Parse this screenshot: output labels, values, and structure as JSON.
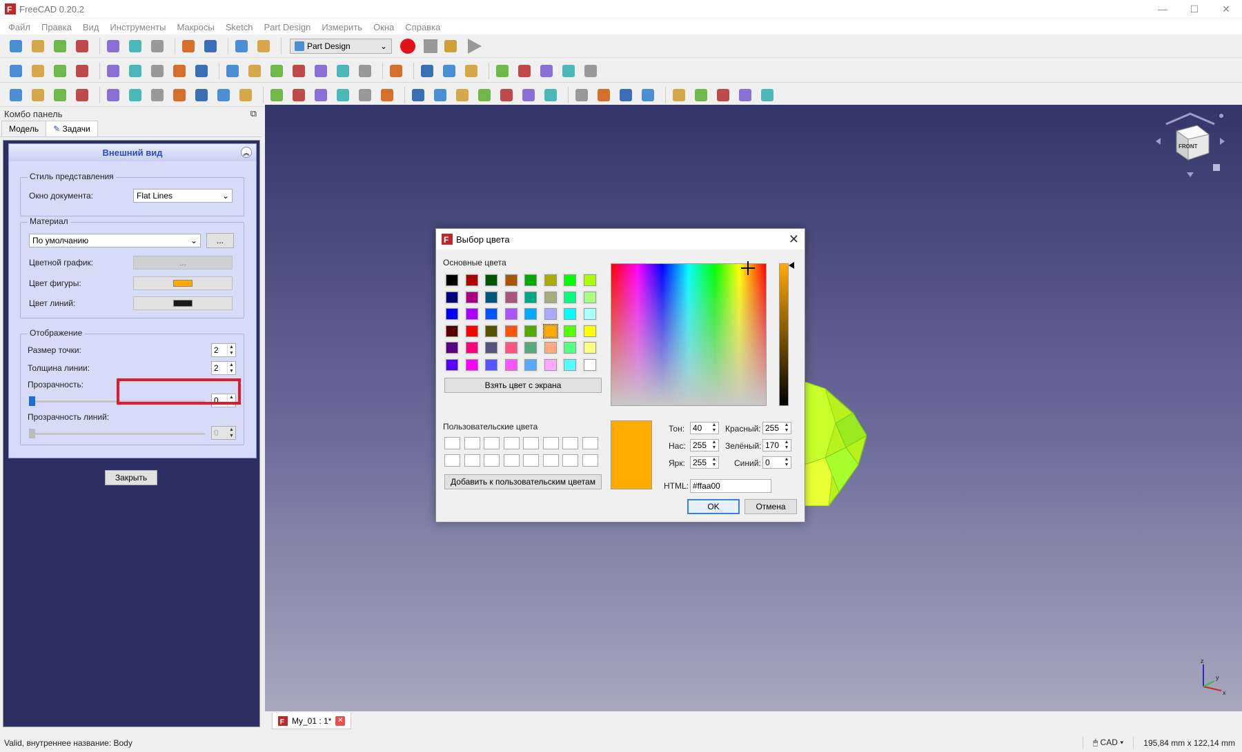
{
  "app": {
    "title": "FreeCAD 0.20.2"
  },
  "window_controls": {
    "minimize": "—",
    "maximize": "☐",
    "close": "✕"
  },
  "menu": [
    "Файл",
    "Правка",
    "Вид",
    "Инструменты",
    "Макросы",
    "Sketch",
    "Part Design",
    "Измерить",
    "Окна",
    "Справка"
  ],
  "toolbar": {
    "workbench": "Part Design",
    "icons_row1": [
      "new-icon",
      "open-icon",
      "save-icon",
      "print-icon",
      "cut-icon",
      "copy-icon",
      "paste-icon",
      "undo-icon",
      "redo-icon",
      "refresh-icon",
      "whats-this-icon"
    ],
    "icons_row2": [
      "fit-all-icon",
      "fit-selection-icon",
      "draw-style-icon",
      "bounding-box-icon",
      "back-icon",
      "forward-icon",
      "std-views-icon",
      "zoom-icon",
      "iso-view-icon",
      "front-view-icon",
      "top-view-icon",
      "right-view-icon",
      "rear-view-icon",
      "bottom-view-icon",
      "left-view-icon",
      "measure-icon",
      "part-icon",
      "group-icon",
      "link-icon",
      "link-actions-icon",
      "measure-linear-icon",
      "measure-angular-icon",
      "measure-clear-icon",
      "measure-toggle-icon",
      "measure-refresh-icon"
    ],
    "icons_row3": [
      "body-icon",
      "sketch-icon",
      "attach-icon",
      "sub-shape-binder-icon",
      "point-icon",
      "line-icon",
      "plane-icon",
      "lcs-icon",
      "shape-binder-icon",
      "clone-icon",
      "clone2-icon",
      "pad-icon",
      "revolve-icon",
      "loft-icon",
      "pipe-icon",
      "helix-icon",
      "primitive-icon",
      "pocket-icon",
      "hole-icon",
      "groove-icon",
      "sub-loft-icon",
      "sub-pipe-icon",
      "sub-helix-icon",
      "sub-primitive-icon",
      "mirror-icon",
      "linear-pattern-icon",
      "polar-pattern-icon",
      "multi-transform-icon",
      "fillet-icon",
      "chamfer-icon",
      "draft-icon",
      "thickness-icon",
      "boolean-icon"
    ]
  },
  "combo": {
    "header": "Комбо панель",
    "tabs": [
      "Модель",
      "Задачи"
    ],
    "task_title": "Внешний вид",
    "group_style": "Стиль представления",
    "doc_window_label": "Окно документа:",
    "doc_window_value": "Flat Lines",
    "group_material": "Материал",
    "material_value": "По умолчанию",
    "material_more": "...",
    "color_plot_label": "Цветной график:",
    "color_plot_value": "...",
    "shape_color_label": "Цвет фигуры:",
    "shape_color": "#ffaa00",
    "line_color_label": "Цвет линий:",
    "line_color": "#1a1a1a",
    "group_display": "Отображение",
    "point_size_label": "Размер точки:",
    "point_size": "2",
    "line_width_label": "Толщина линии:",
    "line_width": "2",
    "transparency_label": "Прозрачность:",
    "transparency": "0",
    "line_transparency_label": "Прозрачность линий:",
    "line_transparency": "0",
    "close_button": "Закрыть"
  },
  "dialog": {
    "title": "Выбор цвета",
    "basic_colors_label": "Основные цвета",
    "basic_colors": [
      "#000000",
      "#aa0000",
      "#005500",
      "#aa5500",
      "#00aa00",
      "#aaaa00",
      "#00ff00",
      "#aaff00",
      "#00007f",
      "#aa007f",
      "#00557f",
      "#aa557f",
      "#00aa7f",
      "#aaaa7f",
      "#00ff7f",
      "#aaff7f",
      "#0000ff",
      "#aa00ff",
      "#0055ff",
      "#aa55ff",
      "#00aaff",
      "#aaaaff",
      "#00ffff",
      "#aaffff",
      "#550000",
      "#ff0000",
      "#555500",
      "#ff5500",
      "#55aa00",
      "#ffaa00",
      "#55ff00",
      "#ffff00",
      "#55007f",
      "#ff007f",
      "#55557f",
      "#ff557f",
      "#55aa7f",
      "#ffaa7f",
      "#55ff7f",
      "#ffff7f",
      "#5500ff",
      "#ff00ff",
      "#5555ff",
      "#ff55ff",
      "#55aaff",
      "#ffaaff",
      "#55ffff",
      "#ffffff"
    ],
    "selected_basic_index": 29,
    "pick_screen_button": "Взять цвет с экрана",
    "custom_colors_label": "Пользовательские цвета",
    "add_custom_button": "Добавить к пользовательским цветам",
    "current_color": "#ffaa00",
    "hue_label": "Тон:",
    "hue": "40",
    "sat_label": "Нас:",
    "sat": "255",
    "val_label": "Ярк:",
    "val": "255",
    "red_label": "Красный:",
    "red": "255",
    "green_label": "Зелёный:",
    "green": "170",
    "blue_label": "Синий:",
    "blue": "0",
    "html_label": "HTML:",
    "html": "#ffaa00",
    "ok_button": "OK",
    "cancel_button": "Отмена"
  },
  "view": {
    "navcube_face": "FRONT",
    "axis_z": "z",
    "axis_x": "x",
    "axis_y": "y"
  },
  "doc_tab": {
    "label": "My_01 : 1*"
  },
  "status": {
    "message": "Valid, внутреннее название: Body",
    "nav_style": "CAD",
    "dimensions": "195,84 mm x 122,14 mm"
  }
}
